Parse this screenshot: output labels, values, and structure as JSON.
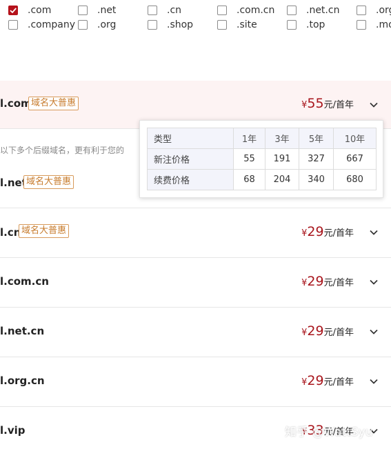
{
  "filters": [
    {
      "label": ".com",
      "checked": true
    },
    {
      "label": ".net",
      "checked": false
    },
    {
      "label": ".cn",
      "checked": false
    },
    {
      "label": ".com.cn",
      "checked": false
    },
    {
      "label": ".net.cn",
      "checked": false
    },
    {
      "label": ".org",
      "checked": false
    },
    {
      "label": ".company",
      "checked": false
    },
    {
      "label": ".org",
      "checked": false
    },
    {
      "label": ".shop",
      "checked": false
    },
    {
      "label": ".site",
      "checked": false
    },
    {
      "label": ".top",
      "checked": false
    },
    {
      "label": ".mo",
      "checked": false
    }
  ],
  "promo_text": "以下多个后缀域名，更有利于您的",
  "rows": [
    {
      "domain": "l.com",
      "tag": "域名大普惠",
      "currency": "¥",
      "price": "55",
      "unit": "元/首年"
    },
    {
      "domain": "l.net",
      "tag": "域名大普惠",
      "currency": "",
      "price": "",
      "unit": ""
    },
    {
      "domain": "l.cn",
      "tag": "域名大普惠",
      "currency": "¥",
      "price": "29",
      "unit": "元/首年"
    },
    {
      "domain": "l.com.cn",
      "tag": "",
      "currency": "¥",
      "price": "29",
      "unit": "元/首年"
    },
    {
      "domain": "l.net.cn",
      "tag": "",
      "currency": "¥",
      "price": "29",
      "unit": "元/首年"
    },
    {
      "domain": "l.org.cn",
      "tag": "",
      "currency": "¥",
      "price": "29",
      "unit": "元/首年"
    },
    {
      "domain": "l.vip",
      "tag": "",
      "currency": "¥",
      "price": "33",
      "unit": "元/首年"
    }
  ],
  "price_table": {
    "headers": [
      "类型",
      "1年",
      "3年",
      "5年",
      "10年"
    ],
    "rows": [
      [
        "新注价格",
        "55",
        "191",
        "327",
        "667"
      ],
      [
        "续费价格",
        "68",
        "204",
        "340",
        "680"
      ]
    ]
  },
  "watermark": "知乎 @WattSyu",
  "colors": {
    "accent": "#b5121b",
    "tag": "#c77b2c",
    "highlight_row": "#fdf3f3"
  }
}
